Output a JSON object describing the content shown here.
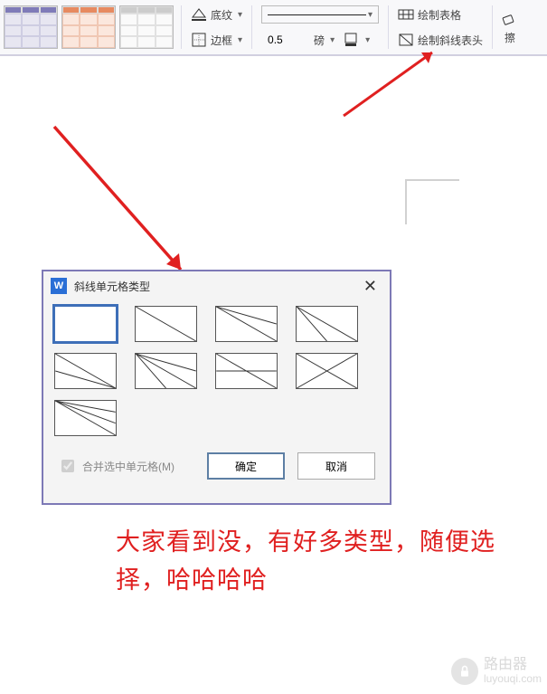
{
  "ribbon": {
    "shading_label": "底纹",
    "border_label": "边框",
    "line_width_value": "0.5",
    "line_width_unit": "磅",
    "draw_table_label": "绘制表格",
    "draw_diagonal_label": "绘制斜线表头",
    "eraser_label": "擦"
  },
  "dialog": {
    "title": "斜线单元格类型",
    "merge_label": "合并选中单元格(M)",
    "ok": "确定",
    "cancel": "取消"
  },
  "annotation": "大家看到没，有好多类型，随便选择，哈哈哈哈",
  "watermark": {
    "brand": "路由器",
    "sub": "luyouqi.com"
  }
}
